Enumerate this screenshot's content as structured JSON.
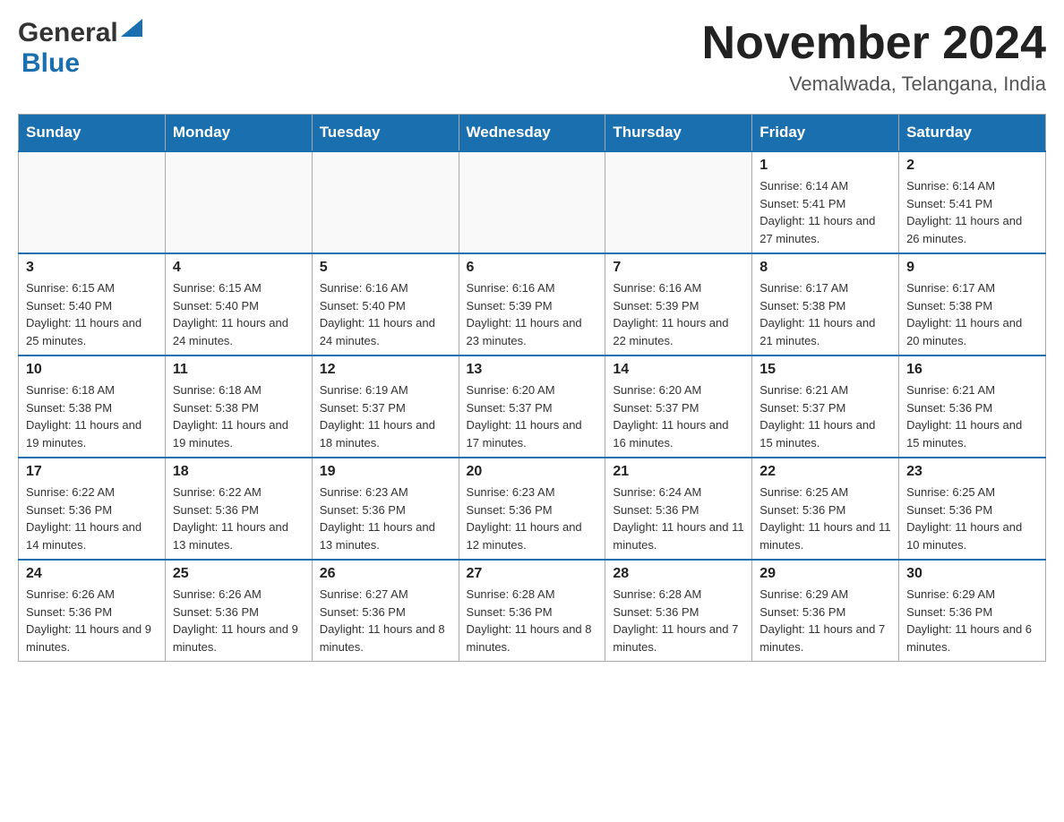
{
  "header": {
    "month_title": "November 2024",
    "location": "Vemalwada, Telangana, India",
    "logo_general": "General",
    "logo_blue": "Blue"
  },
  "days_of_week": [
    "Sunday",
    "Monday",
    "Tuesday",
    "Wednesday",
    "Thursday",
    "Friday",
    "Saturday"
  ],
  "weeks": [
    [
      {
        "day": "",
        "sunrise": "",
        "sunset": "",
        "daylight": ""
      },
      {
        "day": "",
        "sunrise": "",
        "sunset": "",
        "daylight": ""
      },
      {
        "day": "",
        "sunrise": "",
        "sunset": "",
        "daylight": ""
      },
      {
        "day": "",
        "sunrise": "",
        "sunset": "",
        "daylight": ""
      },
      {
        "day": "",
        "sunrise": "",
        "sunset": "",
        "daylight": ""
      },
      {
        "day": "1",
        "sunrise": "Sunrise: 6:14 AM",
        "sunset": "Sunset: 5:41 PM",
        "daylight": "Daylight: 11 hours and 27 minutes."
      },
      {
        "day": "2",
        "sunrise": "Sunrise: 6:14 AM",
        "sunset": "Sunset: 5:41 PM",
        "daylight": "Daylight: 11 hours and 26 minutes."
      }
    ],
    [
      {
        "day": "3",
        "sunrise": "Sunrise: 6:15 AM",
        "sunset": "Sunset: 5:40 PM",
        "daylight": "Daylight: 11 hours and 25 minutes."
      },
      {
        "day": "4",
        "sunrise": "Sunrise: 6:15 AM",
        "sunset": "Sunset: 5:40 PM",
        "daylight": "Daylight: 11 hours and 24 minutes."
      },
      {
        "day": "5",
        "sunrise": "Sunrise: 6:16 AM",
        "sunset": "Sunset: 5:40 PM",
        "daylight": "Daylight: 11 hours and 24 minutes."
      },
      {
        "day": "6",
        "sunrise": "Sunrise: 6:16 AM",
        "sunset": "Sunset: 5:39 PM",
        "daylight": "Daylight: 11 hours and 23 minutes."
      },
      {
        "day": "7",
        "sunrise": "Sunrise: 6:16 AM",
        "sunset": "Sunset: 5:39 PM",
        "daylight": "Daylight: 11 hours and 22 minutes."
      },
      {
        "day": "8",
        "sunrise": "Sunrise: 6:17 AM",
        "sunset": "Sunset: 5:38 PM",
        "daylight": "Daylight: 11 hours and 21 minutes."
      },
      {
        "day": "9",
        "sunrise": "Sunrise: 6:17 AM",
        "sunset": "Sunset: 5:38 PM",
        "daylight": "Daylight: 11 hours and 20 minutes."
      }
    ],
    [
      {
        "day": "10",
        "sunrise": "Sunrise: 6:18 AM",
        "sunset": "Sunset: 5:38 PM",
        "daylight": "Daylight: 11 hours and 19 minutes."
      },
      {
        "day": "11",
        "sunrise": "Sunrise: 6:18 AM",
        "sunset": "Sunset: 5:38 PM",
        "daylight": "Daylight: 11 hours and 19 minutes."
      },
      {
        "day": "12",
        "sunrise": "Sunrise: 6:19 AM",
        "sunset": "Sunset: 5:37 PM",
        "daylight": "Daylight: 11 hours and 18 minutes."
      },
      {
        "day": "13",
        "sunrise": "Sunrise: 6:20 AM",
        "sunset": "Sunset: 5:37 PM",
        "daylight": "Daylight: 11 hours and 17 minutes."
      },
      {
        "day": "14",
        "sunrise": "Sunrise: 6:20 AM",
        "sunset": "Sunset: 5:37 PM",
        "daylight": "Daylight: 11 hours and 16 minutes."
      },
      {
        "day": "15",
        "sunrise": "Sunrise: 6:21 AM",
        "sunset": "Sunset: 5:37 PM",
        "daylight": "Daylight: 11 hours and 15 minutes."
      },
      {
        "day": "16",
        "sunrise": "Sunrise: 6:21 AM",
        "sunset": "Sunset: 5:36 PM",
        "daylight": "Daylight: 11 hours and 15 minutes."
      }
    ],
    [
      {
        "day": "17",
        "sunrise": "Sunrise: 6:22 AM",
        "sunset": "Sunset: 5:36 PM",
        "daylight": "Daylight: 11 hours and 14 minutes."
      },
      {
        "day": "18",
        "sunrise": "Sunrise: 6:22 AM",
        "sunset": "Sunset: 5:36 PM",
        "daylight": "Daylight: 11 hours and 13 minutes."
      },
      {
        "day": "19",
        "sunrise": "Sunrise: 6:23 AM",
        "sunset": "Sunset: 5:36 PM",
        "daylight": "Daylight: 11 hours and 13 minutes."
      },
      {
        "day": "20",
        "sunrise": "Sunrise: 6:23 AM",
        "sunset": "Sunset: 5:36 PM",
        "daylight": "Daylight: 11 hours and 12 minutes."
      },
      {
        "day": "21",
        "sunrise": "Sunrise: 6:24 AM",
        "sunset": "Sunset: 5:36 PM",
        "daylight": "Daylight: 11 hours and 11 minutes."
      },
      {
        "day": "22",
        "sunrise": "Sunrise: 6:25 AM",
        "sunset": "Sunset: 5:36 PM",
        "daylight": "Daylight: 11 hours and 11 minutes."
      },
      {
        "day": "23",
        "sunrise": "Sunrise: 6:25 AM",
        "sunset": "Sunset: 5:36 PM",
        "daylight": "Daylight: 11 hours and 10 minutes."
      }
    ],
    [
      {
        "day": "24",
        "sunrise": "Sunrise: 6:26 AM",
        "sunset": "Sunset: 5:36 PM",
        "daylight": "Daylight: 11 hours and 9 minutes."
      },
      {
        "day": "25",
        "sunrise": "Sunrise: 6:26 AM",
        "sunset": "Sunset: 5:36 PM",
        "daylight": "Daylight: 11 hours and 9 minutes."
      },
      {
        "day": "26",
        "sunrise": "Sunrise: 6:27 AM",
        "sunset": "Sunset: 5:36 PM",
        "daylight": "Daylight: 11 hours and 8 minutes."
      },
      {
        "day": "27",
        "sunrise": "Sunrise: 6:28 AM",
        "sunset": "Sunset: 5:36 PM",
        "daylight": "Daylight: 11 hours and 8 minutes."
      },
      {
        "day": "28",
        "sunrise": "Sunrise: 6:28 AM",
        "sunset": "Sunset: 5:36 PM",
        "daylight": "Daylight: 11 hours and 7 minutes."
      },
      {
        "day": "29",
        "sunrise": "Sunrise: 6:29 AM",
        "sunset": "Sunset: 5:36 PM",
        "daylight": "Daylight: 11 hours and 7 minutes."
      },
      {
        "day": "30",
        "sunrise": "Sunrise: 6:29 AM",
        "sunset": "Sunset: 5:36 PM",
        "daylight": "Daylight: 11 hours and 6 minutes."
      }
    ]
  ]
}
